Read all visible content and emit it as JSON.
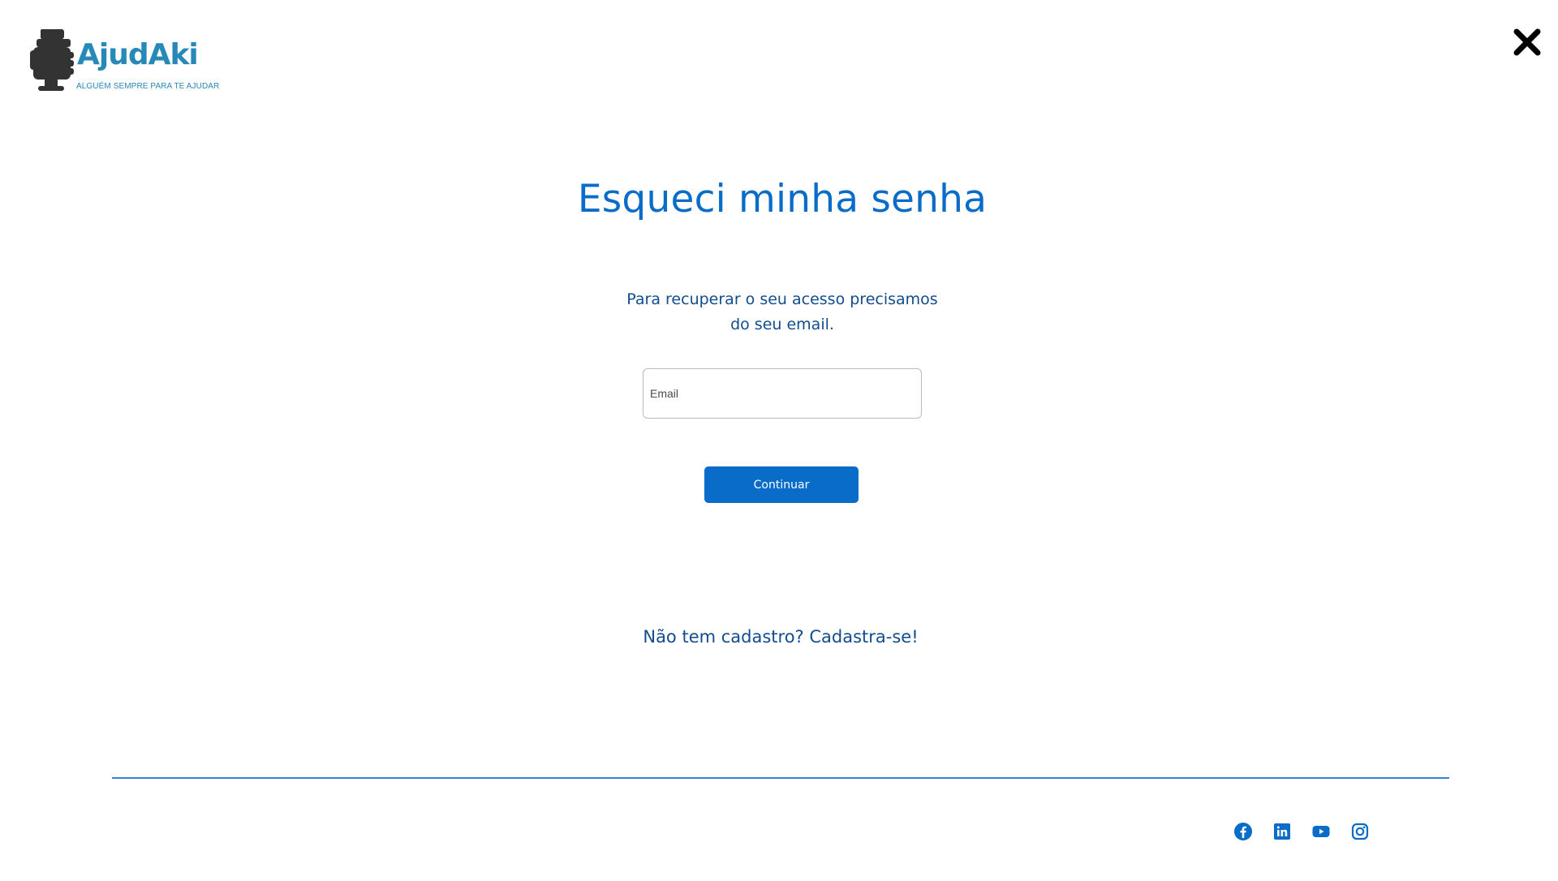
{
  "logo": {
    "name": "AjudAki",
    "tagline": "ALGUÉM SEMPRE PARA TE AJUDAR",
    "icon": "fist-icon"
  },
  "close": {
    "icon": "close-icon"
  },
  "main": {
    "title": "Esqueci minha senha",
    "subtitle": "Para recuperar o seu acesso precisamos do seu email.",
    "email_placeholder": "Email",
    "email_value": "",
    "continue_label": "Continuar",
    "signup_link": "Não tem cadastro? Cadastra-se!"
  },
  "footer": {
    "social": [
      {
        "icon": "facebook-icon"
      },
      {
        "icon": "linkedin-icon"
      },
      {
        "icon": "youtube-icon"
      },
      {
        "icon": "instagram-icon"
      }
    ]
  },
  "colors": {
    "primary": "#0a6cc9",
    "text_dark_blue": "#124c8f",
    "logo_blue": "#2689b8",
    "logo_dark": "#333333",
    "divider": "#3b7fd4"
  }
}
